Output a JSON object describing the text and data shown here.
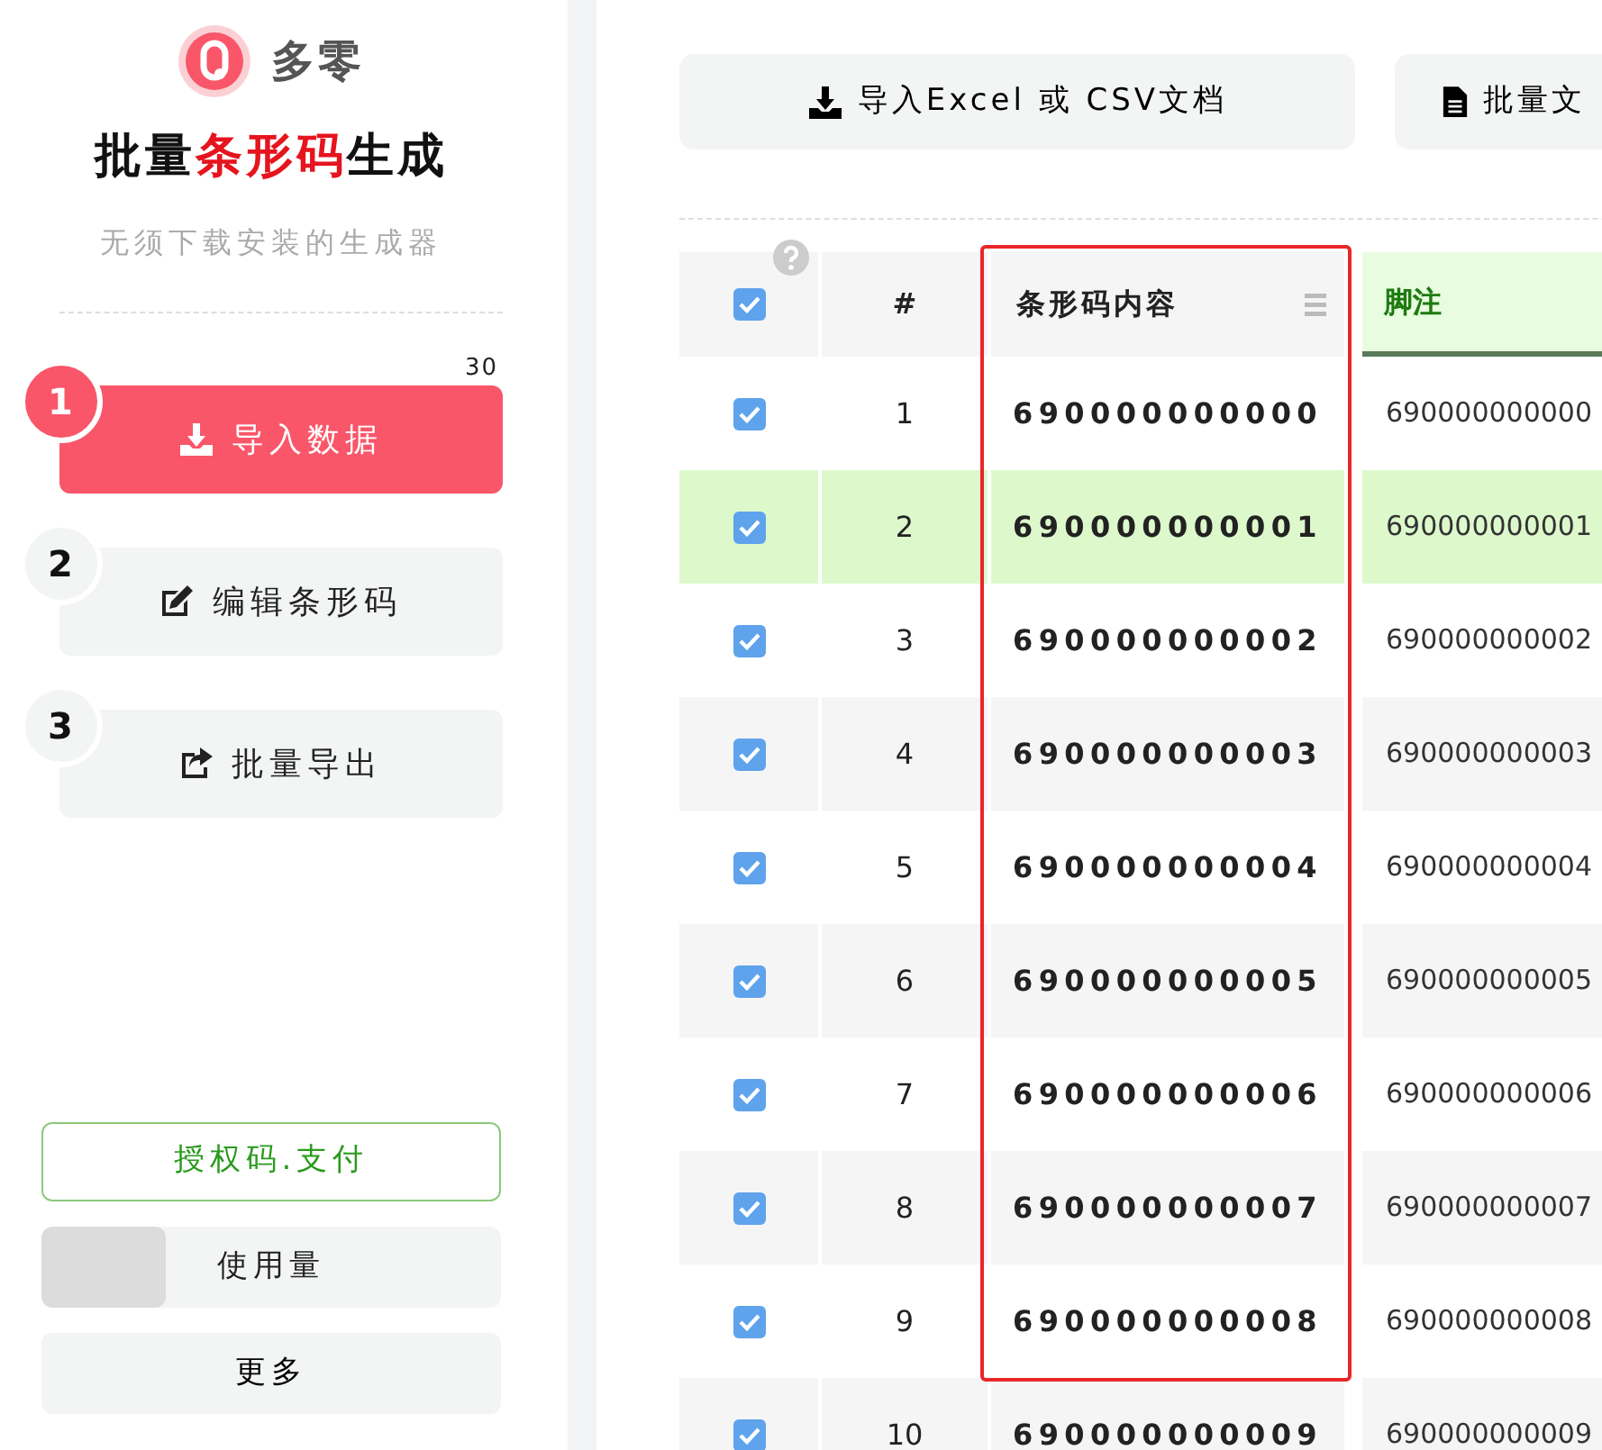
{
  "sidebar": {
    "logo": {
      "name": "多零"
    },
    "title": [
      {
        "text": "批量",
        "accent": false
      },
      {
        "text": "条形码",
        "accent": true
      },
      {
        "text": "生成",
        "accent": false
      }
    ],
    "subtitle": "无须下载安装的生成器",
    "steps": [
      {
        "number": "1",
        "label": "导入数据",
        "count": "30",
        "selected": true
      },
      {
        "number": "2",
        "label": "编辑条形码",
        "selected": false
      },
      {
        "number": "3",
        "label": "批量导出",
        "selected": false
      }
    ],
    "license_button": "授权码.支付",
    "usage": {
      "label": "使用量",
      "level": 0.27
    },
    "more_button": "更多"
  },
  "toolbar": [
    {
      "label": "导入Excel 或 CSV文档"
    },
    {
      "label": "批量文"
    }
  ],
  "table": {
    "select_all_checked": true,
    "columns": [
      {
        "label": "#",
        "framed": false,
        "selected": false
      },
      {
        "label": "条形码内容",
        "framed": true,
        "selected": false
      },
      {
        "label": "脚注",
        "framed": false,
        "selected": true
      }
    ],
    "rows": [
      {
        "checked": true,
        "highlighted": false,
        "cells": [
          "1",
          "690000000000",
          "690000000000"
        ]
      },
      {
        "checked": true,
        "highlighted": true,
        "cells": [
          "2",
          "690000000001",
          "690000000001"
        ]
      },
      {
        "checked": true,
        "highlighted": false,
        "cells": [
          "3",
          "690000000002",
          "690000000002"
        ]
      },
      {
        "checked": true,
        "highlighted": false,
        "cells": [
          "4",
          "690000000003",
          "690000000003"
        ]
      },
      {
        "checked": true,
        "highlighted": false,
        "cells": [
          "5",
          "690000000004",
          "690000000004"
        ]
      },
      {
        "checked": true,
        "highlighted": false,
        "cells": [
          "6",
          "690000000005",
          "690000000005"
        ]
      },
      {
        "checked": true,
        "highlighted": false,
        "cells": [
          "7",
          "690000000006",
          "690000000006"
        ]
      },
      {
        "checked": true,
        "highlighted": false,
        "cells": [
          "8",
          "690000000007",
          "690000000007"
        ]
      },
      {
        "checked": true,
        "highlighted": false,
        "cells": [
          "9",
          "690000000008",
          "690000000008"
        ]
      },
      {
        "checked": true,
        "highlighted": false,
        "cells": [
          "10",
          "690000000009",
          "690000000009"
        ]
      }
    ]
  }
}
